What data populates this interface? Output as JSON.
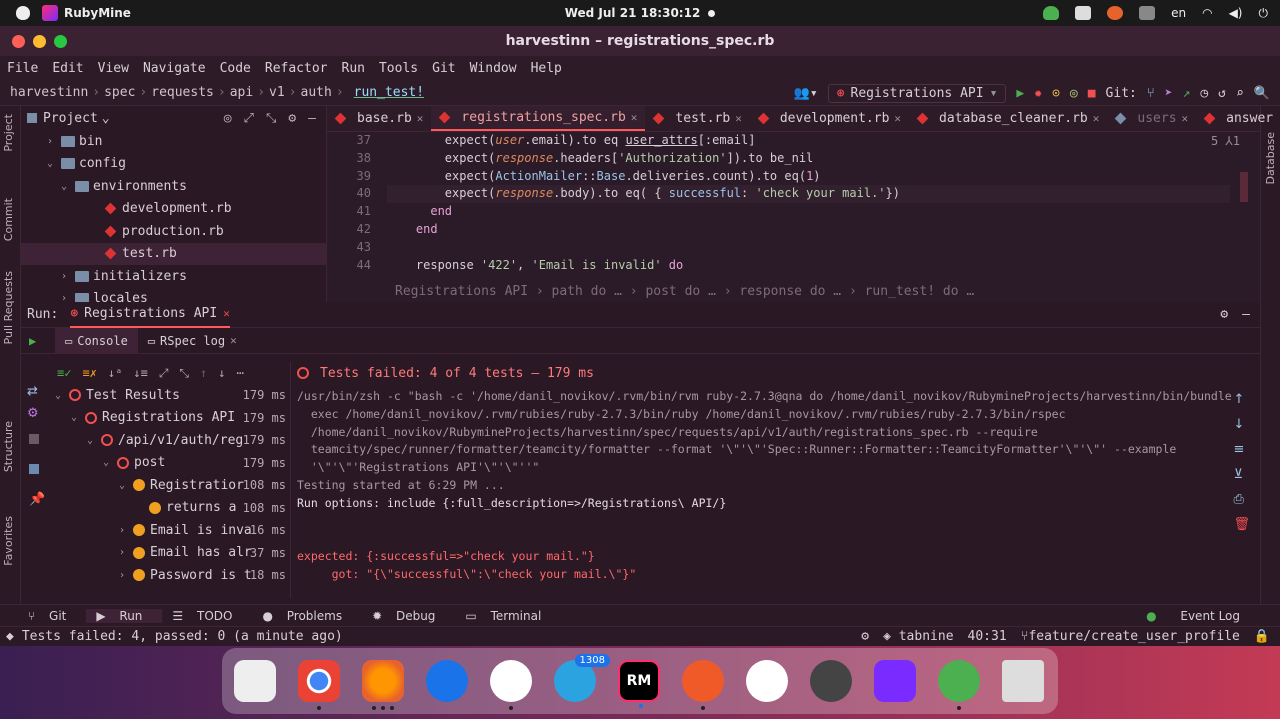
{
  "system": {
    "app_name": "RubyMine",
    "clock": "Wed Jul 21  18:30:12",
    "lang": "en"
  },
  "window": {
    "title": "harvestinn – registrations_spec.rb"
  },
  "menu": [
    "File",
    "Edit",
    "View",
    "Navigate",
    "Code",
    "Refactor",
    "Run",
    "Tools",
    "Git",
    "Window",
    "Help"
  ],
  "nav": {
    "crumbs": [
      "harvestinn",
      "spec",
      "requests",
      "api",
      "v1",
      "auth"
    ],
    "run_target": "run_test!",
    "run_config": "Registrations API",
    "git_label": "Git:"
  },
  "project": {
    "header": "Project",
    "items": [
      {
        "label": "bin",
        "type": "folder",
        "arrow": "›"
      },
      {
        "label": "config",
        "type": "folder",
        "arrow": "⌄"
      },
      {
        "label": "environments",
        "type": "folder",
        "arrow": "⌄"
      },
      {
        "label": "development.rb",
        "type": "ruby",
        "arrow": ""
      },
      {
        "label": "production.rb",
        "type": "ruby",
        "arrow": ""
      },
      {
        "label": "test.rb",
        "type": "ruby",
        "arrow": ""
      },
      {
        "label": "initializers",
        "type": "folder",
        "arrow": "›"
      },
      {
        "label": "locales",
        "type": "folder",
        "arrow": "›"
      }
    ]
  },
  "tabs": [
    "base.rb",
    "registrations_spec.rb",
    "test.rb",
    "development.rb",
    "database_cleaner.rb",
    "users",
    "answer"
  ],
  "editor": {
    "inspection": "5 ⅄1",
    "lines": [
      "37",
      "38",
      "39",
      "40",
      "41",
      "42",
      "43",
      "44"
    ],
    "breadcrumb": "Registrations API  ›  path do …  ›  post do …  ›  response do …  ›  run_test! do …"
  },
  "run": {
    "label": "Run:",
    "config": "Registrations API",
    "tab_console": "Console",
    "tab_rspec": "RSpec log",
    "status": "Tests failed: 4 of 4 tests – 179 ms",
    "tree": [
      {
        "label": "Test Results",
        "time": "179 ms",
        "icon": "fail"
      },
      {
        "label": "Registrations API",
        "time": "179 ms",
        "icon": "fail"
      },
      {
        "label": "/api/v1/auth/reg",
        "time": "179 ms",
        "icon": "fail"
      },
      {
        "label": "post",
        "time": "179 ms",
        "icon": "fail"
      },
      {
        "label": "Registratior",
        "time": "108 ms",
        "icon": "failf"
      },
      {
        "label": "returns a",
        "time": "108 ms",
        "icon": "failf"
      },
      {
        "label": "Email is inva",
        "time": "16 ms",
        "icon": "failf"
      },
      {
        "label": "Email has alr",
        "time": "37 ms",
        "icon": "failf"
      },
      {
        "label": "Password is t",
        "time": "18 ms",
        "icon": "failf"
      }
    ],
    "console": [
      "/usr/bin/zsh -c \"bash -c '/home/danil_novikov/.rvm/bin/rvm ruby-2.7.3@qna do /home/danil_novikov/RubymineProjects/harvestinn/bin/bundle",
      "  exec /home/danil_novikov/.rvm/rubies/ruby-2.7.3/bin/ruby /home/danil_novikov/.rvm/rubies/ruby-2.7.3/bin/rspec",
      "  /home/danil_novikov/RubymineProjects/harvestinn/spec/requests/api/v1/auth/registrations_spec.rb --require",
      "  teamcity/spec/runner/formatter/teamcity/formatter --format '\\\"'\\\"'Spec::Runner::Formatter::TeamcityFormatter'\\\"'\\\"' --example",
      "  '\\\"'\\\"'Registrations API'\\\"'\\\"''\"",
      "Testing started at 6:29 PM ...",
      "Run options: include {:full_description=>/Registrations\\ API/}",
      "",
      "",
      "expected: {:successful=>\"check your mail.\"}",
      "     got: \"{\\\"successful\\\":\\\"check your mail.\\\"}\""
    ]
  },
  "toolwindows": [
    "Git",
    "Run",
    "TODO",
    "Problems",
    "Debug",
    "Terminal"
  ],
  "event_log": "Event Log",
  "side_left": [
    "Project",
    "Commit",
    "Pull Requests",
    "Structure",
    "Favorites"
  ],
  "side_right": [
    "Database"
  ],
  "statusbar": {
    "message": "Tests failed: 4, passed: 0 (a minute ago)",
    "tabnine": "tabnine",
    "position": "40:31",
    "branch": "feature/create_user_profile"
  },
  "dock": {
    "telegram_badge": "1308",
    "rm_label": "RM"
  }
}
